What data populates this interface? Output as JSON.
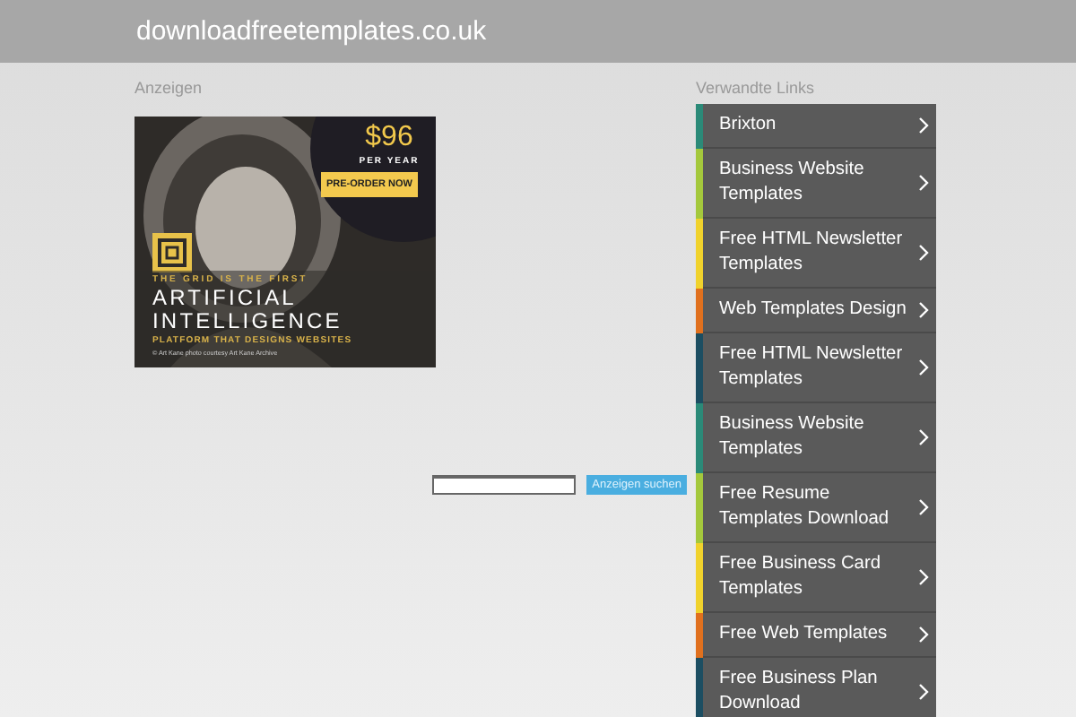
{
  "header": {
    "title": "downloadfreetemplates.co.uk"
  },
  "ads": {
    "heading": "Anzeigen",
    "banner": {
      "price": "$96",
      "period": "PER YEAR",
      "cta": "PRE-ORDER NOW",
      "tagline": "THE GRID IS THE FIRST",
      "headline_1": "ARTIFICIAL",
      "headline_2": "INTELLIGENCE",
      "subline": "PLATFORM THAT DESIGNS WEBSITES",
      "credit": "© Art Kane  photo courtesy Art Kane Archive"
    }
  },
  "search": {
    "button": "Anzeigen suchen"
  },
  "related": {
    "heading": "Verwandte Links",
    "items": [
      {
        "label": "Brixton",
        "color": "#2b8a78"
      },
      {
        "label": "Business Website Templates",
        "color": "#a4c83c"
      },
      {
        "label": "Free HTML Newsletter Templates",
        "color": "#f0d22c"
      },
      {
        "label": "Web Templates Design",
        "color": "#e0701e"
      },
      {
        "label": "Free HTML Newsletter Templates",
        "color": "#1c4e62"
      },
      {
        "label": "Business Website Templates",
        "color": "#2b8a78"
      },
      {
        "label": "Free Resume Templates Download",
        "color": "#a4c83c"
      },
      {
        "label": "Free Business Card Templates",
        "color": "#f0d22c"
      },
      {
        "label": "Free Web Templates",
        "color": "#e0701e"
      },
      {
        "label": "Free Business Plan Download",
        "color": "#1c4e62"
      }
    ]
  }
}
